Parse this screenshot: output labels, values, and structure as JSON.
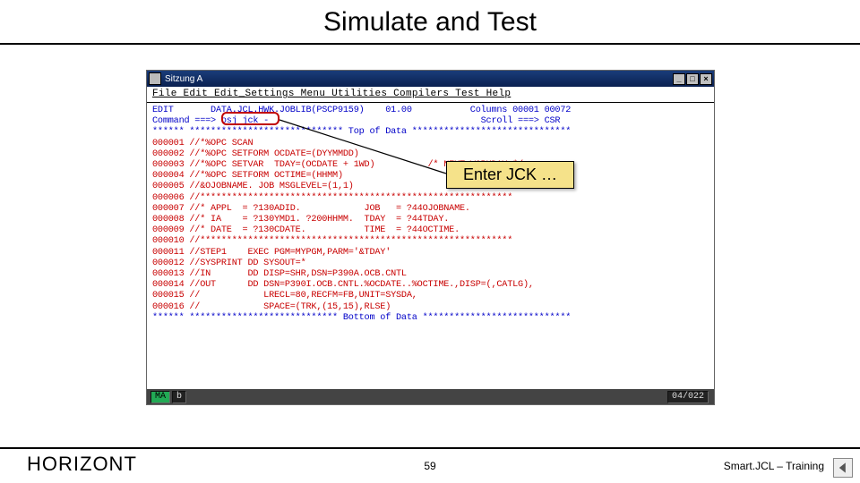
{
  "slide": {
    "title": "Simulate and Test",
    "page_number": "59",
    "brand": "HORIZONT",
    "training_label": "Smart.JCL – Training"
  },
  "window": {
    "title": "Sitzung A",
    "min": "_",
    "max": "□",
    "close": "×"
  },
  "menubar": {
    "items": "File  Edit  Edit_Settings  Menu  Utilities  Compilers  Test  Help"
  },
  "editor": {
    "header_line": "EDIT       DATA.JCL.HWK.JOBLIB(PSCP9159)    01.00           Columns 00001 00072",
    "cmd_line": "Command ===> osj jck -                                        Scroll ===> CSR",
    "top_line": "****** ***************************** Top of Data ******************************",
    "body": "000001 //*%OPC SCAN\n000002 //*%OPC SETFORM OCDATE=(DYYMMDD)\n000003 //*%OPC SETVAR  TDAY=(OCDATE + 1WD)          /* NEXT WORKDAY */\n000004 //*%OPC SETFORM OCTIME=(HHMM)\n000005 //&OJOBNAME. JOB MSGLEVEL=(1,1)\n000006 //***********************************************************\n000007 //* APPL  = ?130ADID.            JOB   = ?44OJOBNAME.\n000008 //* IA    = ?130YMD1. ?200HHMM.  TDAY  = ?44TDAY.\n000009 //* DATE  = ?130CDATE.           TIME  = ?44OCTIME.\n000010 //***********************************************************\n000011 //STEP1    EXEC PGM=MYPGM,PARM='&TDAY'\n000012 //SYSPRINT DD SYSOUT=*\n000013 //IN       DD DISP=SHR,DSN=P390A.OCB.CNTL\n000014 //OUT      DD DSN=P390I.OCB.CNTL.%OCDATE..%OCTIME.,DISP=(,CATLG),\n000015 //            LRECL=80,RECFM=FB,UNIT=SYSDA,\n000016 //            SPACE=(TRK,(15,15),RLSE)",
    "bottom_line": "****** **************************** Bottom of Data ****************************"
  },
  "callout": {
    "text": "Enter JCK …"
  },
  "status": {
    "ma": "MA",
    "b": "b",
    "pos": "04/022"
  }
}
